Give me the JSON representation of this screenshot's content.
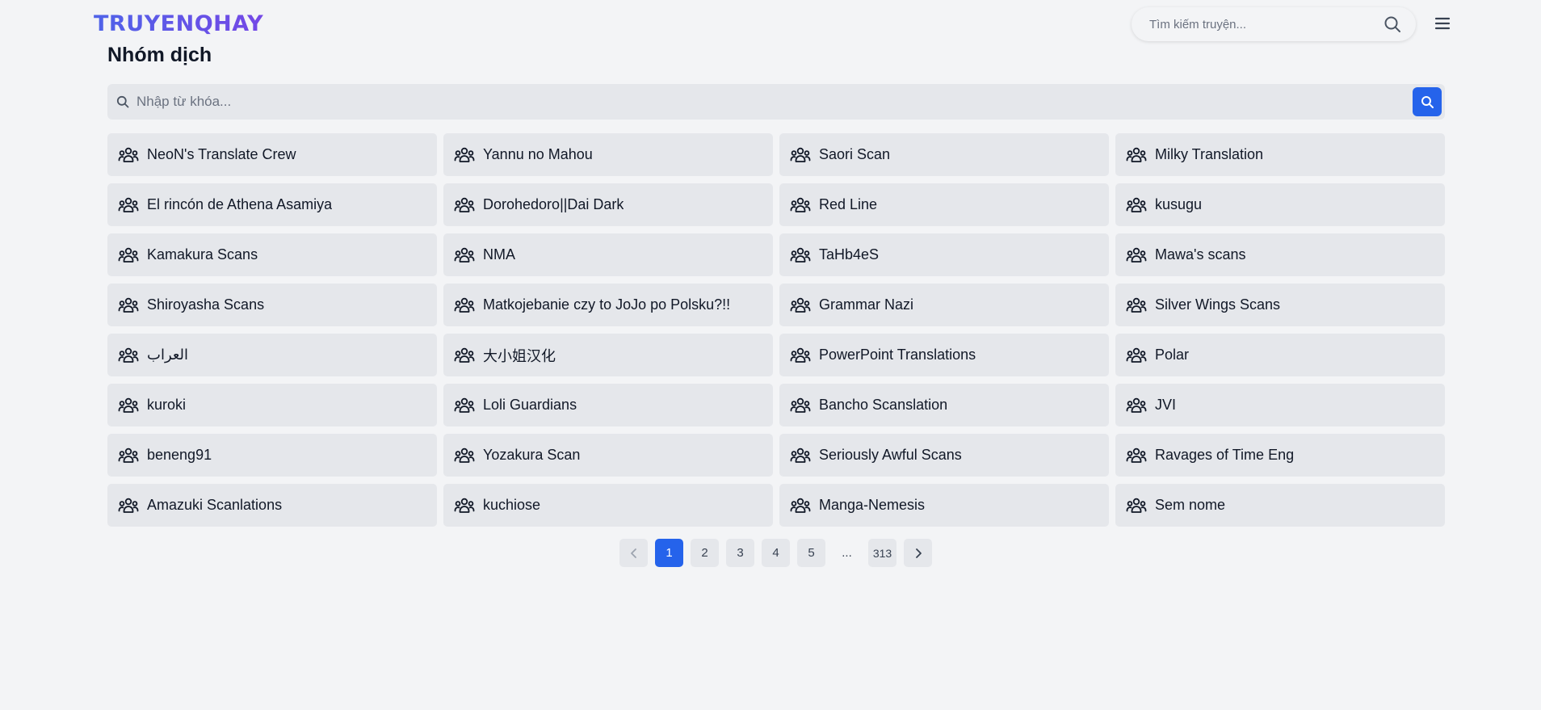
{
  "header": {
    "logo": "TRUYENQHAY",
    "search_placeholder": "Tìm kiếm truyện...",
    "search_icon": "search-icon",
    "menu_icon": "hamburger-menu-icon"
  },
  "page": {
    "title": "Nhóm dịch",
    "keyword_placeholder": "Nhập từ khóa..."
  },
  "groups": [
    "NeoN's Translate Crew",
    "Yannu no Mahou",
    "Saori Scan",
    "Milky Translation",
    "El rincón de Athena Asamiya",
    "Dorohedoro||Dai Dark",
    "Red Line",
    "kusugu",
    "Kamakura Scans",
    "NMA",
    "TaHb4eS",
    "Mawa's scans",
    "Shiroyasha Scans",
    "Matkojebanie czy to JoJo po Polsku?!!",
    "Grammar Nazi",
    "Silver Wings Scans",
    "العراب",
    "大小姐汉化",
    "PowerPoint Translations",
    "Polar",
    "kuroki",
    "Loli Guardians",
    "Bancho Scanslation",
    "JVI",
    "beneng91",
    "Yozakura Scan",
    "Seriously Awful Scans",
    "Ravages of Time Eng",
    "Amazuki Scanlations",
    "kuchiose",
    "Manga-Nemesis",
    "Sem nome"
  ],
  "group_icon": "users-group-icon",
  "pagination": {
    "prev_icon": "chevron-left-icon",
    "next_icon": "chevron-right-icon",
    "pages": [
      "1",
      "2",
      "3",
      "4",
      "5",
      "...",
      "313"
    ],
    "current": "1"
  },
  "colors": {
    "accent": "#2563eb",
    "background": "#f3f4f6",
    "card": "#e5e7eb",
    "logo_gradient_start": "#4f63e8",
    "logo_gradient_end": "#7448e6"
  }
}
